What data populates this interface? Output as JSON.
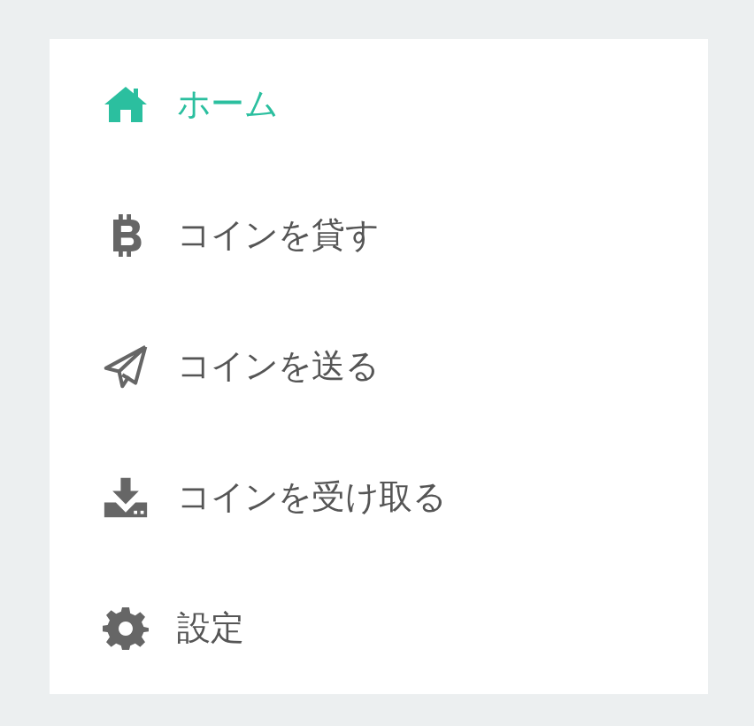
{
  "menu": [
    {
      "label": "ホーム",
      "kind": "home",
      "selected": true
    },
    {
      "label": "コインを貸す",
      "kind": "coin",
      "selected": false
    },
    {
      "label": "コインを送る",
      "kind": "send",
      "selected": false
    },
    {
      "label": "コインを受け取る",
      "kind": "receive",
      "selected": false
    },
    {
      "label": "設定",
      "kind": "settings",
      "selected": false
    }
  ]
}
